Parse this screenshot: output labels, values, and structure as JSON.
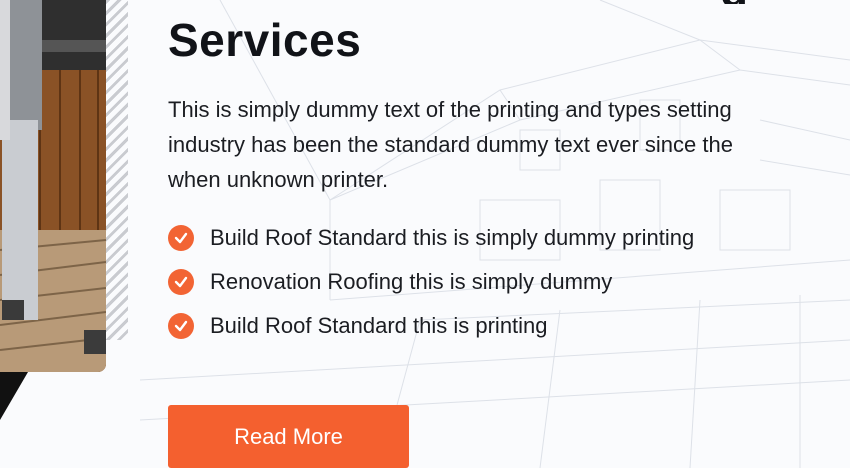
{
  "section": {
    "title": "Services",
    "description": "This is simply dummy text of the printing and types setting industry has been the standard dummy text ever since the when unknown printer.",
    "features": [
      {
        "icon": "check-circle-icon",
        "label": "Build Roof Standard this is simply dummy printing"
      },
      {
        "icon": "check-circle-icon",
        "label": "Renovation Roofing this is simply dummy"
      },
      {
        "icon": "check-circle-icon",
        "label": "Build Roof Standard this is printing"
      }
    ],
    "cta_label": "Read More"
  },
  "colors": {
    "accent": "#f4602f",
    "text": "#1b1d22",
    "background": "#fafbfd"
  }
}
